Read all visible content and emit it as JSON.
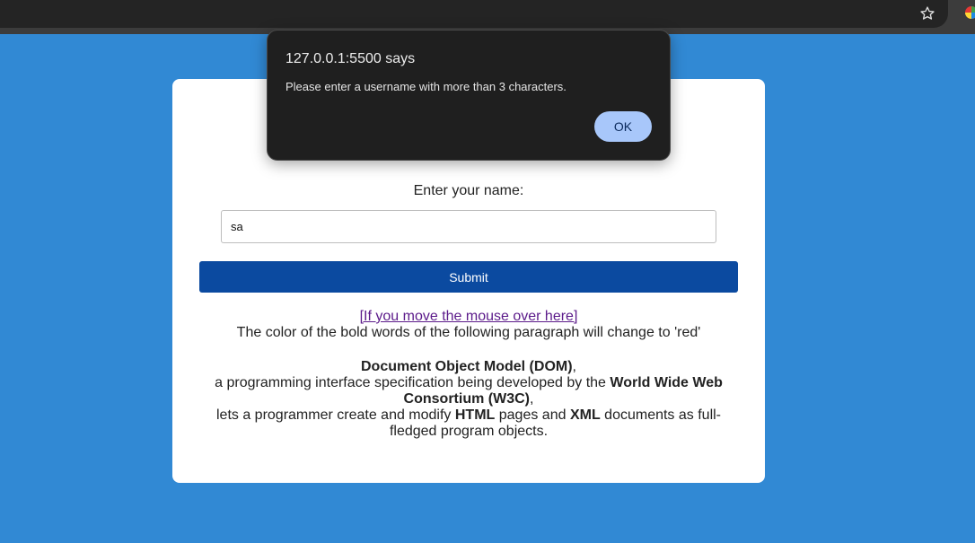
{
  "browser": {
    "bookmark_icon": "star-icon",
    "extension_icon": "color-wheel-icon"
  },
  "form": {
    "label": "Enter your name:",
    "input_value": "sa",
    "submit_label": "Submit",
    "submit_color": "#0b4aa0"
  },
  "content": {
    "link_text": "[If you move the mouse over here]",
    "intro": "The color of the bold words of the following paragraph will change to 'red'",
    "dom_term": "Document Object Model (DOM)",
    "comma": ",",
    "line2_text": "a programming interface specification being developed by the ",
    "w3c_term": "World Wide Web Consortium (W3C)",
    "line3_start": "lets a programmer create and modify ",
    "html_term": "HTML",
    "line3_mid": " pages and ",
    "xml_term": "XML",
    "line3_end": " documents as full-fledged program objects."
  },
  "alert": {
    "title": "127.0.0.1:5500 says",
    "message": "Please enter a username with more than 3 characters.",
    "ok_label": "OK"
  },
  "colors": {
    "page_background": "#3189d4",
    "alert_background": "#1f1f1f",
    "ok_button": "#a8c7fa"
  }
}
